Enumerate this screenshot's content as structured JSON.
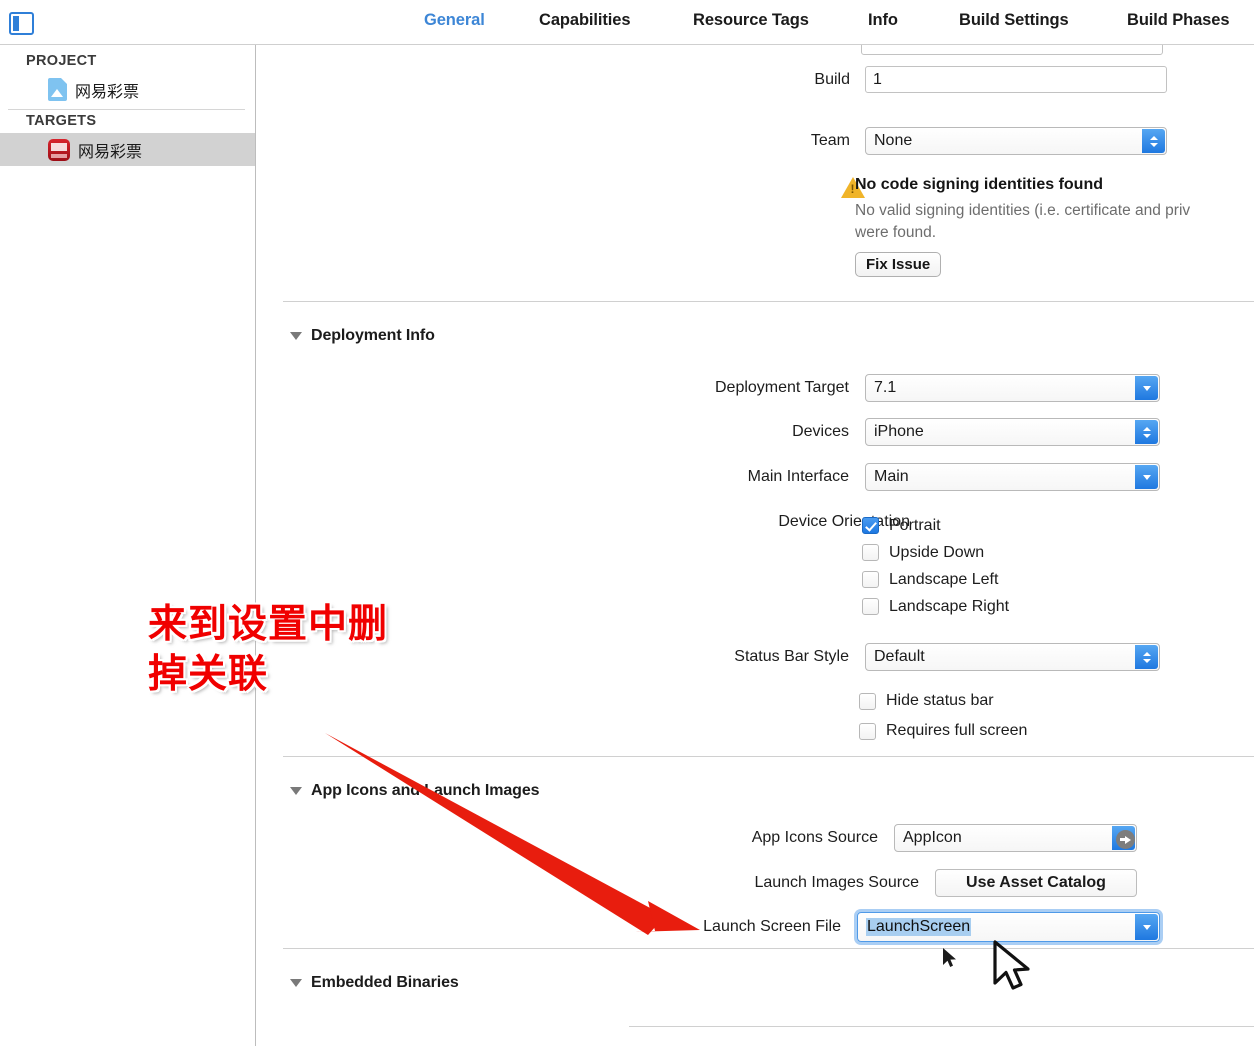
{
  "toolbar": {
    "navigator_toggle": "navigator-toggle"
  },
  "tabs": [
    {
      "label": "General",
      "active": true
    },
    {
      "label": "Capabilities",
      "active": false
    },
    {
      "label": "Resource Tags",
      "active": false
    },
    {
      "label": "Info",
      "active": false
    },
    {
      "label": "Build Settings",
      "active": false
    },
    {
      "label": "Build Phases",
      "active": false
    }
  ],
  "sidebar": {
    "project_header": "PROJECT",
    "targets_header": "TARGETS",
    "project_items": [
      {
        "label": "网易彩票",
        "icon": "project-document-icon"
      }
    ],
    "target_items": [
      {
        "label": "网易彩票",
        "icon": "app-bundle-icon",
        "selected": true
      }
    ]
  },
  "identity": {
    "build_label": "Build",
    "build_value": "1",
    "team_label": "Team",
    "team_value": "None",
    "warning_title": "No code signing identities found",
    "warning_body_line1": "No valid signing identities (i.e. certificate and priv",
    "warning_body_line2": "were found.",
    "fix_issue_label": "Fix Issue"
  },
  "deployment_info": {
    "section_title": "Deployment Info",
    "deployment_target_label": "Deployment Target",
    "deployment_target_value": "7.1",
    "devices_label": "Devices",
    "devices_value": "iPhone",
    "main_interface_label": "Main Interface",
    "main_interface_value": "Main",
    "device_orientation_label": "Device Orientation",
    "orientations": [
      {
        "label": "Portrait",
        "checked": true
      },
      {
        "label": "Upside Down",
        "checked": false
      },
      {
        "label": "Landscape Left",
        "checked": false
      },
      {
        "label": "Landscape Right",
        "checked": false
      }
    ],
    "status_bar_style_label": "Status Bar Style",
    "status_bar_style_value": "Default",
    "extra_options": [
      {
        "label": "Hide status bar",
        "checked": false
      },
      {
        "label": "Requires full screen",
        "checked": false
      }
    ]
  },
  "app_icons": {
    "section_title": "App Icons and Launch Images",
    "app_icons_source_label": "App Icons Source",
    "app_icons_source_value": "AppIcon",
    "launch_images_source_label": "Launch Images Source",
    "launch_images_source_value": "Use Asset Catalog",
    "launch_screen_file_label": "Launch Screen File",
    "launch_screen_file_value": "LaunchScreen"
  },
  "embedded_binaries": {
    "section_title": "Embedded Binaries"
  },
  "annotation": {
    "text": "来到设置中删\n掉关联",
    "color": "#f00000",
    "arrow_color": "#e81d0e"
  },
  "colors": {
    "accent_blue": "#3d86d6",
    "control_blue": "#1f78e0",
    "selection_blue": "#a8cef0",
    "warning_yellow": "#f0b429",
    "selected_row_gray": "#d2d2d2"
  }
}
